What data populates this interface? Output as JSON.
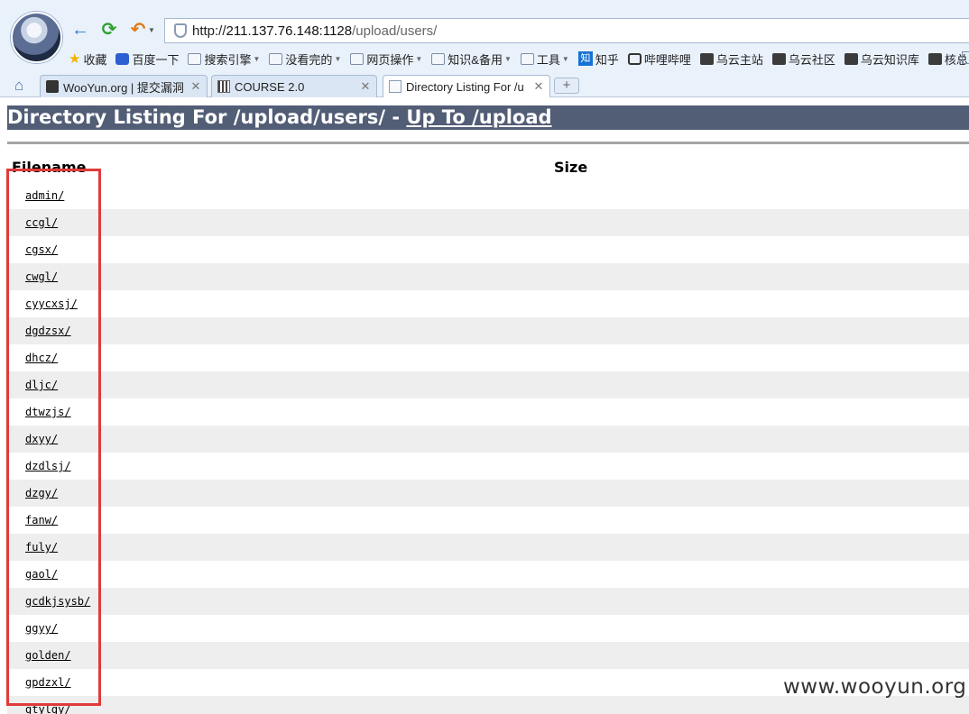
{
  "browser": {
    "address": {
      "scheme": "http://",
      "host": "211.137.76.148:1128",
      "path": "/upload/users/"
    },
    "bookmarks": [
      {
        "label": "收藏",
        "icon": "star-icon",
        "dropdown": false
      },
      {
        "label": "百度一下",
        "icon": "paw-icon",
        "dropdown": false
      },
      {
        "label": "搜索引擎",
        "icon": "folder-icon",
        "dropdown": true
      },
      {
        "label": "没看完的",
        "icon": "folder-icon",
        "dropdown": true
      },
      {
        "label": "网页操作",
        "icon": "folder-icon",
        "dropdown": true
      },
      {
        "label": "知识&备用",
        "icon": "folder-icon",
        "dropdown": true
      },
      {
        "label": "工具",
        "icon": "folder-icon",
        "dropdown": true
      },
      {
        "label": "知乎",
        "icon": "zhihu-icon",
        "dropdown": false
      },
      {
        "label": "哔哩哔哩",
        "icon": "bilibili-icon",
        "dropdown": false
      },
      {
        "label": "乌云主站",
        "icon": "wooyun-icon",
        "dropdown": false
      },
      {
        "label": "乌云社区",
        "icon": "wooyun-icon",
        "dropdown": false
      },
      {
        "label": "乌云知识库",
        "icon": "wooyun-icon",
        "dropdown": false
      },
      {
        "label": "核总",
        "icon": "site-icon",
        "dropdown": false
      }
    ],
    "tabs": [
      {
        "label": "WooYun.org | 提交漏洞",
        "active": false
      },
      {
        "label": "COURSE 2.0",
        "active": false
      },
      {
        "label": "Directory Listing For /u",
        "active": true
      }
    ],
    "zhihu_glyph": "知"
  },
  "page": {
    "heading_text": "Directory Listing For /upload/users/ - ",
    "heading_link": "Up To /upload",
    "columns": {
      "filename": "Filename",
      "size": "Size"
    },
    "files": [
      "admin/",
      "ccgl/",
      "cgsx/",
      "cwgl/",
      "cyycxsj/",
      "dgdzsx/",
      "dhcz/",
      "dljc/",
      "dtwzjs/",
      "dxyy/",
      "dzdlsj/",
      "dzgy/",
      "fanw/",
      "fuly/",
      "gaol/",
      "gcdkjsysb/",
      "ggyy/",
      "golden/",
      "gpdzxl/",
      "gtylgy/"
    ]
  },
  "watermark": "www.wooyun.org",
  "colors": {
    "heading_bg": "#525d76",
    "alt_row": "#eeeeee",
    "highlight_box": "#e03b3b"
  }
}
